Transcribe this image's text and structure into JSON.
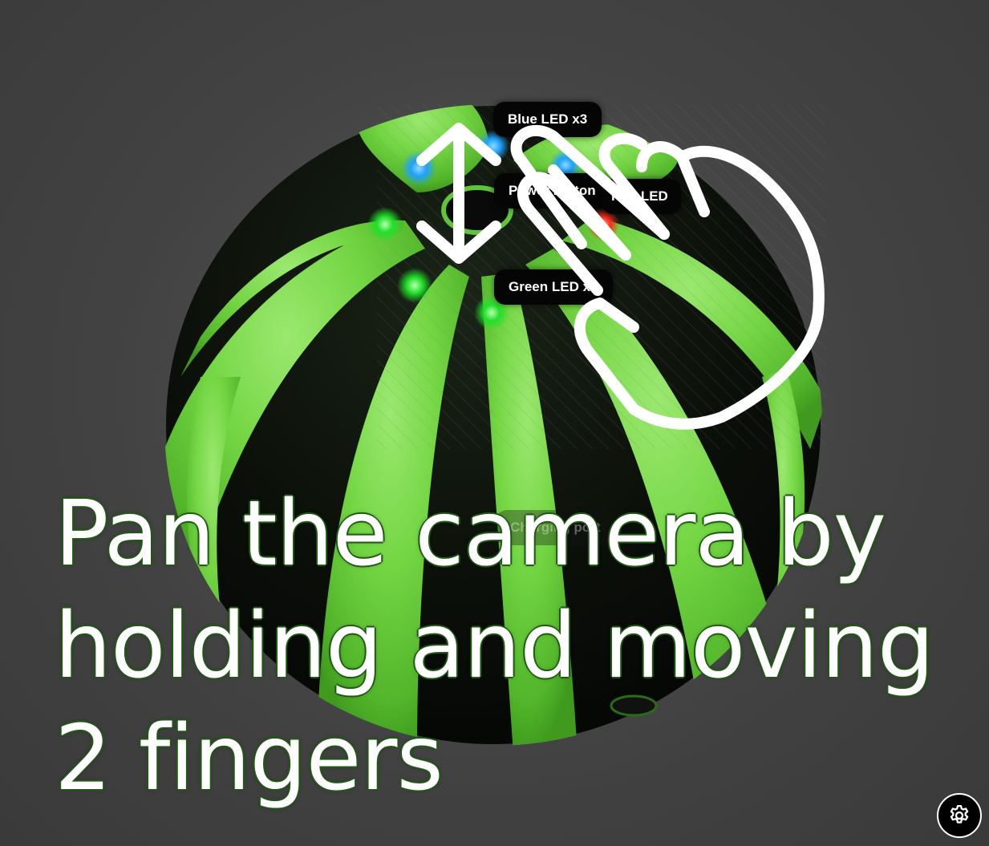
{
  "viewer": {
    "background_color": "#3d3d3d",
    "model_color": "#6fd43a"
  },
  "hotspots": [
    {
      "label": "Blue LED x3",
      "color": "#2aa8ff"
    },
    {
      "label": "Power button"
    },
    {
      "label": "Red LED",
      "color": "#ff2a2a"
    },
    {
      "label": "Green LED x4",
      "color": "#22e02a"
    },
    {
      "label": "Charging port"
    }
  ],
  "gesture": {
    "icon": "two-finger-pan-icon"
  },
  "hint": {
    "text": "Pan the camera by holding and moving 2 fingers"
  },
  "settings": {
    "icon": "gear-icon"
  }
}
